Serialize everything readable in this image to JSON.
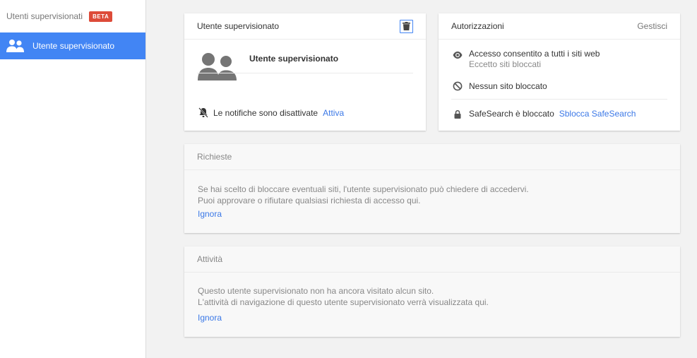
{
  "sidebar": {
    "title": "Utenti supervisionati",
    "badge": "BETA",
    "items": [
      {
        "label": "Utente supervisionato",
        "icon": "people-icon",
        "selected": true
      }
    ]
  },
  "user_card": {
    "title": "Utente supervisionato",
    "delete_icon": "trash-icon",
    "user_name": "Utente supervisionato",
    "avatar_icon": "people-icon",
    "notifications_text": "Le notifiche sono disattivate",
    "notifications_link": "Attiva",
    "notifications_icon": "bell-off-icon"
  },
  "permissions_card": {
    "title": "Autorizzazioni",
    "manage_link": "Gestisci",
    "access_title": "Accesso consentito a tutti i siti web",
    "access_subtitle": "Eccetto siti bloccati",
    "blocked_text": "Nessun sito bloccato",
    "safesearch_text": "SafeSearch è bloccato",
    "safesearch_link": "Sblocca SafeSearch"
  },
  "requests_card": {
    "title": "Richieste",
    "line1": "Se hai scelto di bloccare eventuali siti, l'utente supervisionato può chiedere di accedervi.",
    "line2": "Puoi approvare o rifiutare qualsiasi richiesta di accesso qui.",
    "dismiss": "Ignora"
  },
  "activity_card": {
    "title": "Attività",
    "line1": "Questo utente supervisionato non ha ancora visitato alcun sito.",
    "line2": "L'attività di navigazione di questo utente supervisionato verrà visualizzata qui.",
    "dismiss": "Ignora"
  },
  "colors": {
    "accent": "#4285f4",
    "link": "#3b78e7",
    "badge": "#dd4b39",
    "background": "#f2f2f2"
  }
}
